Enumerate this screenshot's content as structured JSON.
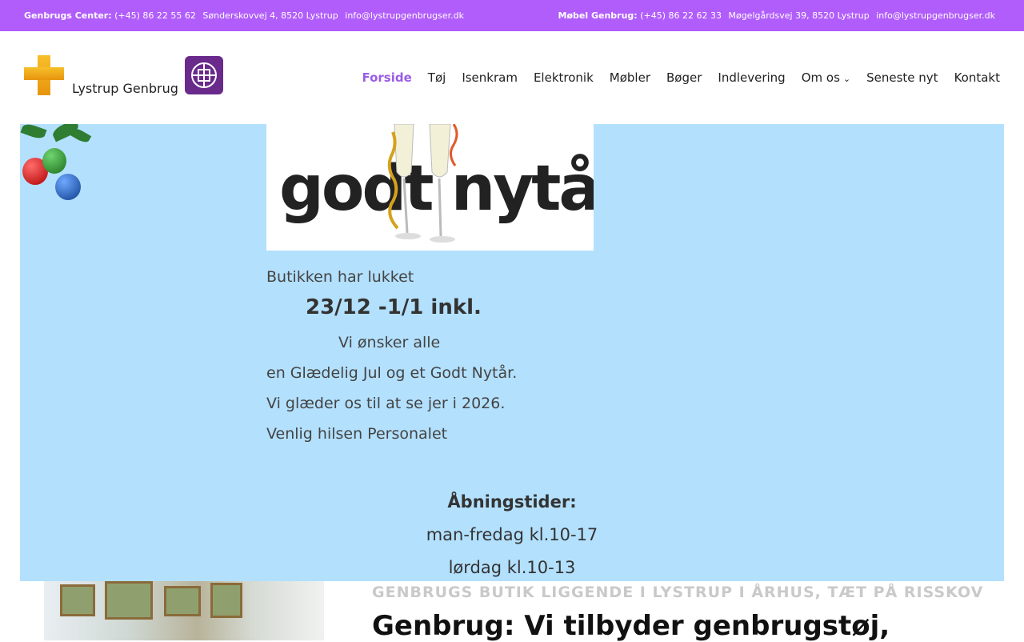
{
  "topbar": {
    "left": {
      "label": "Genbrugs Center:",
      "phone": "(+45) 86 22 55 62",
      "address": "Sønderskovvej 4, 8520 Lystrup",
      "email": "info@lystrupgenbrugser.dk"
    },
    "right": {
      "label": "Møbel Genbrug:",
      "phone": "(+45) 86 22 62 33",
      "address": "Møgelgårdsvej 39, 8520 Lystrup",
      "email": "info@lystrupgenbrugser.dk"
    }
  },
  "brand": {
    "name": "Lystrup Genbrug",
    "accent": "#b15dfb"
  },
  "nav": {
    "items": [
      "Forside",
      "Tøj",
      "Isenkram",
      "Elektronik",
      "Møbler",
      "Bøger",
      "Indlevering",
      "Om os",
      "Seneste nyt",
      "Kontakt"
    ],
    "active": "Forside"
  },
  "hero": {
    "banner_text": "godt nytår",
    "closed": "Butikken har lukket",
    "dates": "23/12 -1/1 inkl.",
    "wish": "Vi ønsker alle",
    "greeting": "en Glædelig Jul og et Godt Nytår.",
    "looking_forward": "Vi glæder os til at se jer i 2026.",
    "regards": "Venlig hilsen Personalet",
    "hours_title": "Åbningstider:",
    "hours_weekday": "man-fredag kl.10-17",
    "hours_saturday": "lørdag kl.10-13",
    "background": "#b3e0fd"
  },
  "content": {
    "tagline": "GENBRUGS BUTIK LIGGENDE I LYSTRUP I ÅRHUS, TÆT PÅ RISSKOV",
    "headline": "Genbrug: Vi tilbyder genbrugstøj,"
  }
}
